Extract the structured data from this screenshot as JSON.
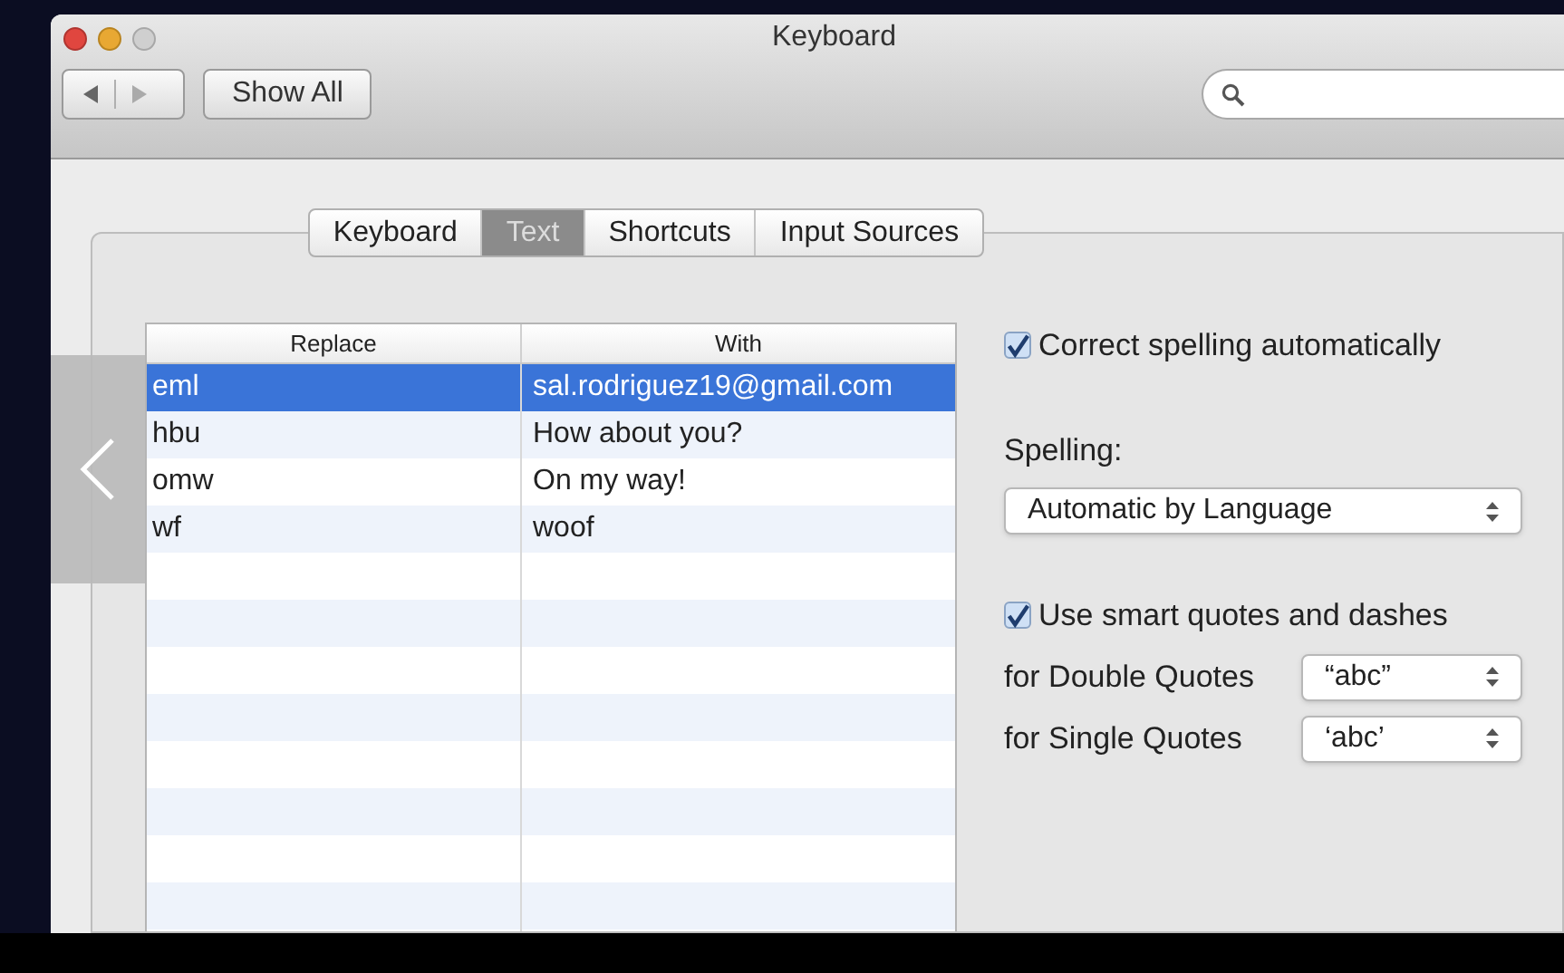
{
  "window": {
    "title": "Keyboard"
  },
  "toolbar": {
    "back": {
      "disabled": false
    },
    "forward": {
      "disabled": true
    },
    "show_all": "Show All"
  },
  "tabs": [
    {
      "label": "Keyboard",
      "selected": false
    },
    {
      "label": "Text",
      "selected": true
    },
    {
      "label": "Shortcuts",
      "selected": false
    },
    {
      "label": "Input Sources",
      "selected": false
    }
  ],
  "table": {
    "columns": [
      "Replace",
      "With"
    ],
    "rows": [
      {
        "replace": "eml",
        "with": "sal.rodriguez19@gmail.com",
        "selected": true
      },
      {
        "replace": "hbu",
        "with": "How about you?",
        "selected": false
      },
      {
        "replace": "omw",
        "with": "On my way!",
        "selected": false
      },
      {
        "replace": "wf",
        "with": "woof",
        "selected": false
      }
    ]
  },
  "options": [
    {
      "kind": "checkbox",
      "label": "Correct spelling automatically",
      "checked": true
    },
    {
      "kind": "label",
      "label": "Spelling:"
    },
    {
      "kind": "select",
      "value": "Automatic by Language"
    },
    {
      "kind": "checkbox",
      "label": "Use smart quotes and dashes",
      "checked": true
    },
    {
      "kind": "labeled-select",
      "label": "for Double Quotes",
      "value": "“abc”"
    },
    {
      "kind": "labeled-select",
      "label": "for Single Quotes",
      "value": "‘abc’"
    }
  ],
  "gallery": {
    "previous_button": true
  }
}
